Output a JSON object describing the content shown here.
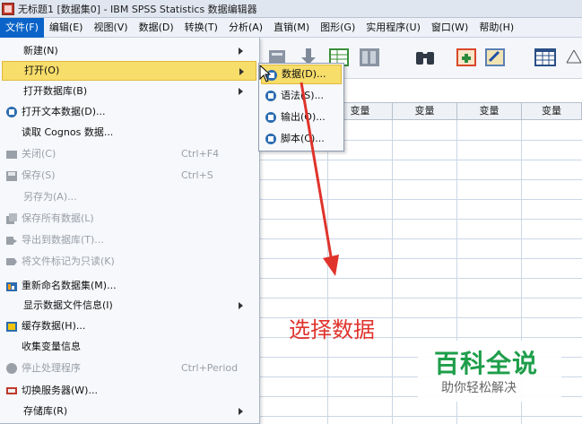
{
  "window": {
    "title": "无标题1 [数据集0] - IBM SPSS Statistics 数据编辑器"
  },
  "menubar": [
    "文件(F)",
    "编辑(E)",
    "视图(V)",
    "数据(D)",
    "转换(T)",
    "分析(A)",
    "直销(M)",
    "图形(G)",
    "实用程序(U)",
    "窗口(W)",
    "帮助(H)"
  ],
  "file_menu": {
    "items": [
      {
        "label": "新建(N)"
      },
      {
        "label": "打开(O)"
      },
      {
        "label": "打开数据库(B)"
      },
      {
        "label": "打开文本数据(D)..."
      },
      {
        "label": "读取 Cognos 数据..."
      },
      {
        "label": "关闭(C)",
        "shortcut": "Ctrl+F4"
      },
      {
        "label": "保存(S)",
        "shortcut": "Ctrl+S"
      },
      {
        "label": "另存为(A)..."
      },
      {
        "label": "保存所有数据(L)"
      },
      {
        "label": "导出到数据库(T)..."
      },
      {
        "label": "将文件标记为只读(K)"
      },
      {
        "label": "重新命名数据集(M)..."
      },
      {
        "label": "显示数据文件信息(I)"
      },
      {
        "label": "缓存数据(H)..."
      },
      {
        "label": "收集变量信息"
      },
      {
        "label": "停止处理程序",
        "shortcut": "Ctrl+Period"
      },
      {
        "label": "切换服务器(W)..."
      },
      {
        "label": "存储库(R)"
      }
    ]
  },
  "open_submenu": {
    "items": [
      {
        "label": "数据(D)..."
      },
      {
        "label": "语法(S)..."
      },
      {
        "label": "输出(O)..."
      },
      {
        "label": "脚本(C)..."
      }
    ]
  },
  "grid": {
    "column_headers": [
      "变量",
      "变量",
      "变量",
      "变量"
    ]
  },
  "annotation": {
    "text": "选择数据",
    "color": "#e0332c"
  },
  "watermark": {
    "title": "百科全说",
    "subtitle": "助你轻松解决"
  }
}
